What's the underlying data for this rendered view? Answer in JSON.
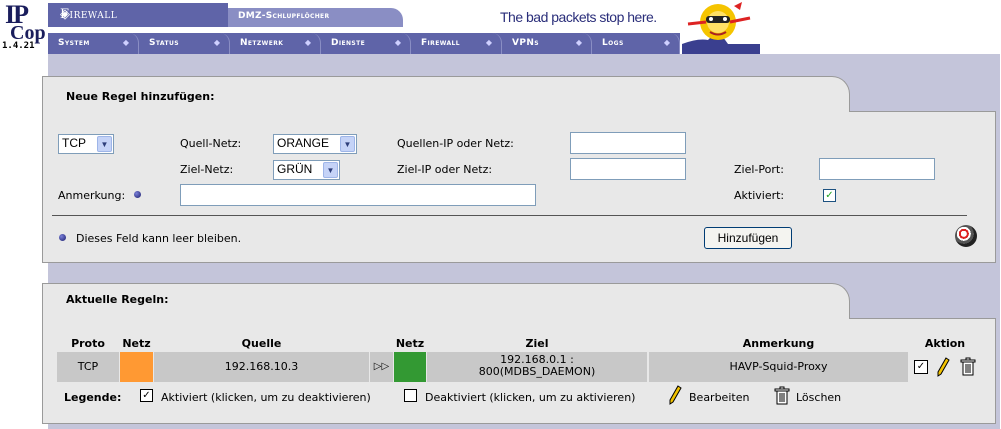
{
  "header": {
    "logo_ip": "IP",
    "logo_cop": "Cop",
    "version": "1.4.21",
    "section_title": "Firewall",
    "subsection_title": "DMZ-Schlupflöcher",
    "tagline": "The bad packets stop here.",
    "nav_tabs": [
      {
        "label": "System"
      },
      {
        "label": "Status"
      },
      {
        "label": "Netzwerk"
      },
      {
        "label": "Dienste"
      },
      {
        "label": "Firewall"
      },
      {
        "label": "VPNs"
      },
      {
        "label": "Logs"
      }
    ]
  },
  "new_rule": {
    "title": "Neue Regel hinzufügen:",
    "protocol": "TCP",
    "source_net_label": "Quell-Netz:",
    "source_net_value": "ORANGE",
    "source_ip_label": "Quellen-IP oder Netz:",
    "source_ip_value": "",
    "dest_net_label": "Ziel-Netz:",
    "dest_net_value": "GRÜN",
    "dest_ip_label": "Ziel-IP oder Netz:",
    "dest_ip_value": "",
    "dest_port_label": "Ziel-Port:",
    "dest_port_value": "",
    "remark_label": "Anmerkung:",
    "remark_value": "",
    "enabled_label": "Aktiviert:",
    "enabled": true,
    "optional_note": "Dieses Feld kann leer bleiben.",
    "add_button": "Hinzufügen"
  },
  "current_rules": {
    "title": "Aktuelle Regeln:",
    "columns": {
      "proto": "Proto",
      "src_net": "Netz",
      "source": "Quelle",
      "dst_net": "Netz",
      "dest": "Ziel",
      "remark": "Anmerkung",
      "action": "Aktion"
    },
    "rows": [
      {
        "proto": "TCP",
        "src_net_color": "#ff9933",
        "source": "192.168.10.3",
        "dst_net_color": "#339933",
        "dest_line1": "192.168.0.1 :",
        "dest_line2": "800(MDBS_DAEMON)",
        "remark": "HAVP-Squid-Proxy",
        "enabled": true
      }
    ],
    "legend": {
      "label": "Legende:",
      "enabled_text": "Aktiviert (klicken, um zu deaktivieren)",
      "disabled_text": "Deaktiviert (klicken, um zu aktivieren)",
      "edit_text": "Bearbeiten",
      "delete_text": "Löschen"
    }
  },
  "colors": {
    "nav_blue": "#5f64a8",
    "page_bg": "#c4c5da",
    "panel_bg": "#e8e8e8",
    "orange_net": "#ff9933",
    "green_net": "#339933"
  }
}
